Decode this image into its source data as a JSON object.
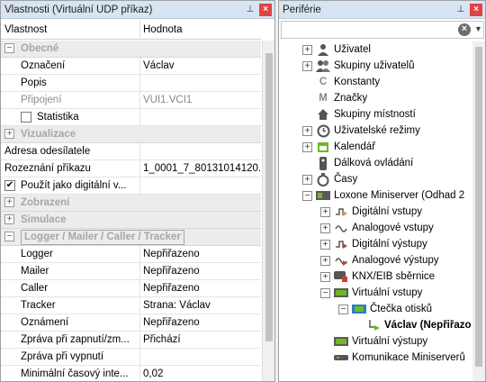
{
  "left_panel": {
    "title": "Vlastnosti (Virtuální UDP příkaz)",
    "pin_glyph": "⊥",
    "close_glyph": "×",
    "col_property": "Vlastnost",
    "col_value": "Hodnota",
    "cat_general": "Obecné",
    "row_oznaceni": {
      "name": "Označení",
      "value": "Václav"
    },
    "row_popis": {
      "name": "Popis",
      "value": ""
    },
    "row_pripojeni": {
      "name": "Připojení",
      "value": "VUI1.VCI1"
    },
    "row_statistika": {
      "name": "Statistika"
    },
    "cat_visual": "Vizualizace",
    "row_adresa": {
      "name": "Adresa odesílatele",
      "value": ""
    },
    "row_rozeznani": {
      "name": "Rozeznání příkazu",
      "value": "1_0001_7_80131014120..."
    },
    "row_pouzit": {
      "name": "Použít jako digitální v..."
    },
    "cat_display": "Zobrazení",
    "cat_simulation": "Simulace",
    "cat_logger": "Logger / Mailer / Caller / Tracker",
    "row_logger": {
      "name": "Logger",
      "value": "Nepřiřazeno"
    },
    "row_mailer": {
      "name": "Mailer",
      "value": "Nepřiřazeno"
    },
    "row_caller": {
      "name": "Caller",
      "value": "Nepřiřazeno"
    },
    "row_tracker": {
      "name": "Tracker",
      "value": "Strana: Václav"
    },
    "row_oznameni": {
      "name": "Oznámení",
      "value": "Nepřiřazeno"
    },
    "row_zprava_on": {
      "name": "Zpráva při zapnutí/zm...",
      "value": "Přichází"
    },
    "row_zprava_off": {
      "name": "Zpráva při vypnutí",
      "value": ""
    },
    "row_min_cas": {
      "name": "Minimální časový inte...",
      "value": "0,02"
    }
  },
  "right_panel": {
    "title": "Periférie",
    "tree": {
      "uzivatel": "Uživatel",
      "skupiny_uzivatelu": "Skupiny uživatelů",
      "konstanty": "Konstanty",
      "znacky": "Značky",
      "skupiny_mistnosti": "Skupiny místností",
      "uzivatelske_rezimy": "Uživatelské režimy",
      "kalendar": "Kalendář",
      "dalkova_ovladani": "Dálková ovládání",
      "casy": "Časy",
      "miniserver": "Loxone Miniserver (Odhad 2",
      "digitalni_vstupy": "Digitální vstupy",
      "analogove_vstupy": "Analogové vstupy",
      "digitalni_vystupy": "Digitální výstupy",
      "analogove_vystupy": "Analogové výstupy",
      "knx": "KNX/EIB sběrnice",
      "virtualni_vstupy": "Virtuální vstupy",
      "ctecka": "Čtečka otisků",
      "vaclav": "Václav (Nepřiřazo",
      "virtualni_vystupy": "Virtuální výstupy",
      "komunikace": "Komunikace Miniserverů"
    }
  },
  "colors": {
    "accent_green": "#6fb821",
    "title_bg": "#d7e4f2",
    "close_red": "#e04343"
  }
}
